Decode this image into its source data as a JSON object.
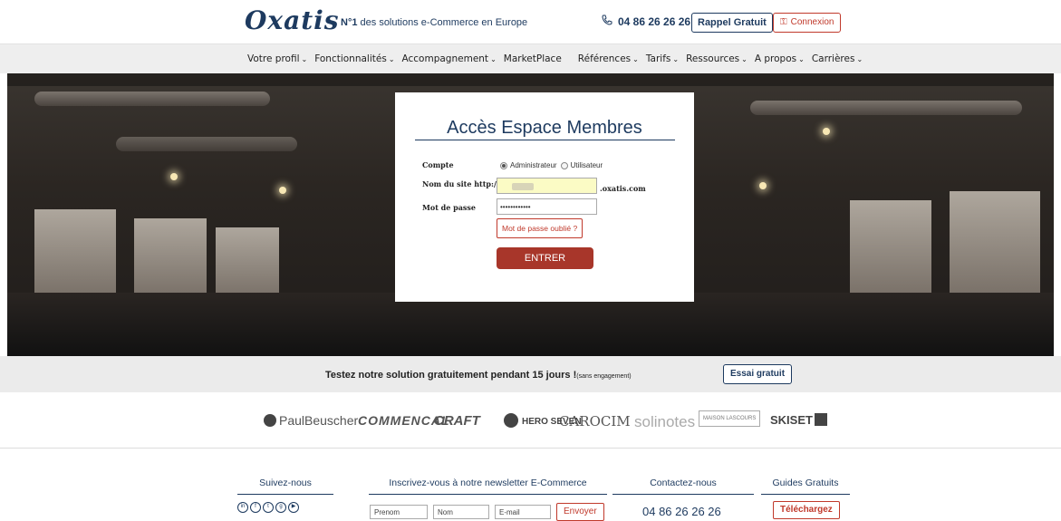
{
  "header": {
    "logo_text": "Oxatis",
    "tagline_bold": "N°1",
    "tagline_rest": " des solutions e-Commerce en Europe",
    "phone_icon": "phone-icon",
    "phone": "04 86 26 26 26",
    "callback_label": "Rappel Gratuit",
    "login_label": "Connexion"
  },
  "nav": {
    "items": [
      {
        "label": "Votre profil"
      },
      {
        "label": "Fonctionnalités"
      },
      {
        "label": "Accompagnement"
      },
      {
        "label": "MarketPlace"
      },
      {
        "label": "Références"
      },
      {
        "label": "Tarifs"
      },
      {
        "label": "Ressources"
      },
      {
        "label": "A propos"
      },
      {
        "label": "Carrières"
      }
    ]
  },
  "login": {
    "title": "Accès Espace Membres",
    "account_label": "Compte",
    "option_admin": "Administrateur",
    "option_user": "Utilisateur",
    "site_label": "Nom du site http://",
    "site_suffix": ".oxatis.com",
    "password_label": "Mot de passe",
    "password_value": "••••••••••••",
    "forgot_label": "Mot de passe oublié ?",
    "enter_label": "ENTRER"
  },
  "trial": {
    "text": "Testez notre solution gratuitement pendant 15 jours !",
    "small": "(sans engagement)",
    "button": "Essai gratuit"
  },
  "brands": [
    "PaulBeuscher",
    "COMMENCAL",
    "CRAFT",
    "HERO SEVEN",
    "CAROCIM",
    "solinotes",
    "MAISON LASCOURS",
    "SKISET"
  ],
  "footer": {
    "follow_title": "Suivez-nous",
    "newsletter_title": "Inscrivez-vous à notre newsletter E-Commerce",
    "contact_title": "Contactez-nous",
    "guides_title": "Guides Gratuits",
    "first_name_placeholder": "Prenom",
    "last_name_placeholder": "Nom",
    "email_placeholder": "E-mail",
    "send_label": "Envoyer",
    "phone": "04 86 26 26 26",
    "download_label": "Téléchargez"
  },
  "colors": {
    "brand_blue": "#1d3a5f",
    "accent_red": "#c0392b",
    "enter_red": "#a8362a"
  }
}
